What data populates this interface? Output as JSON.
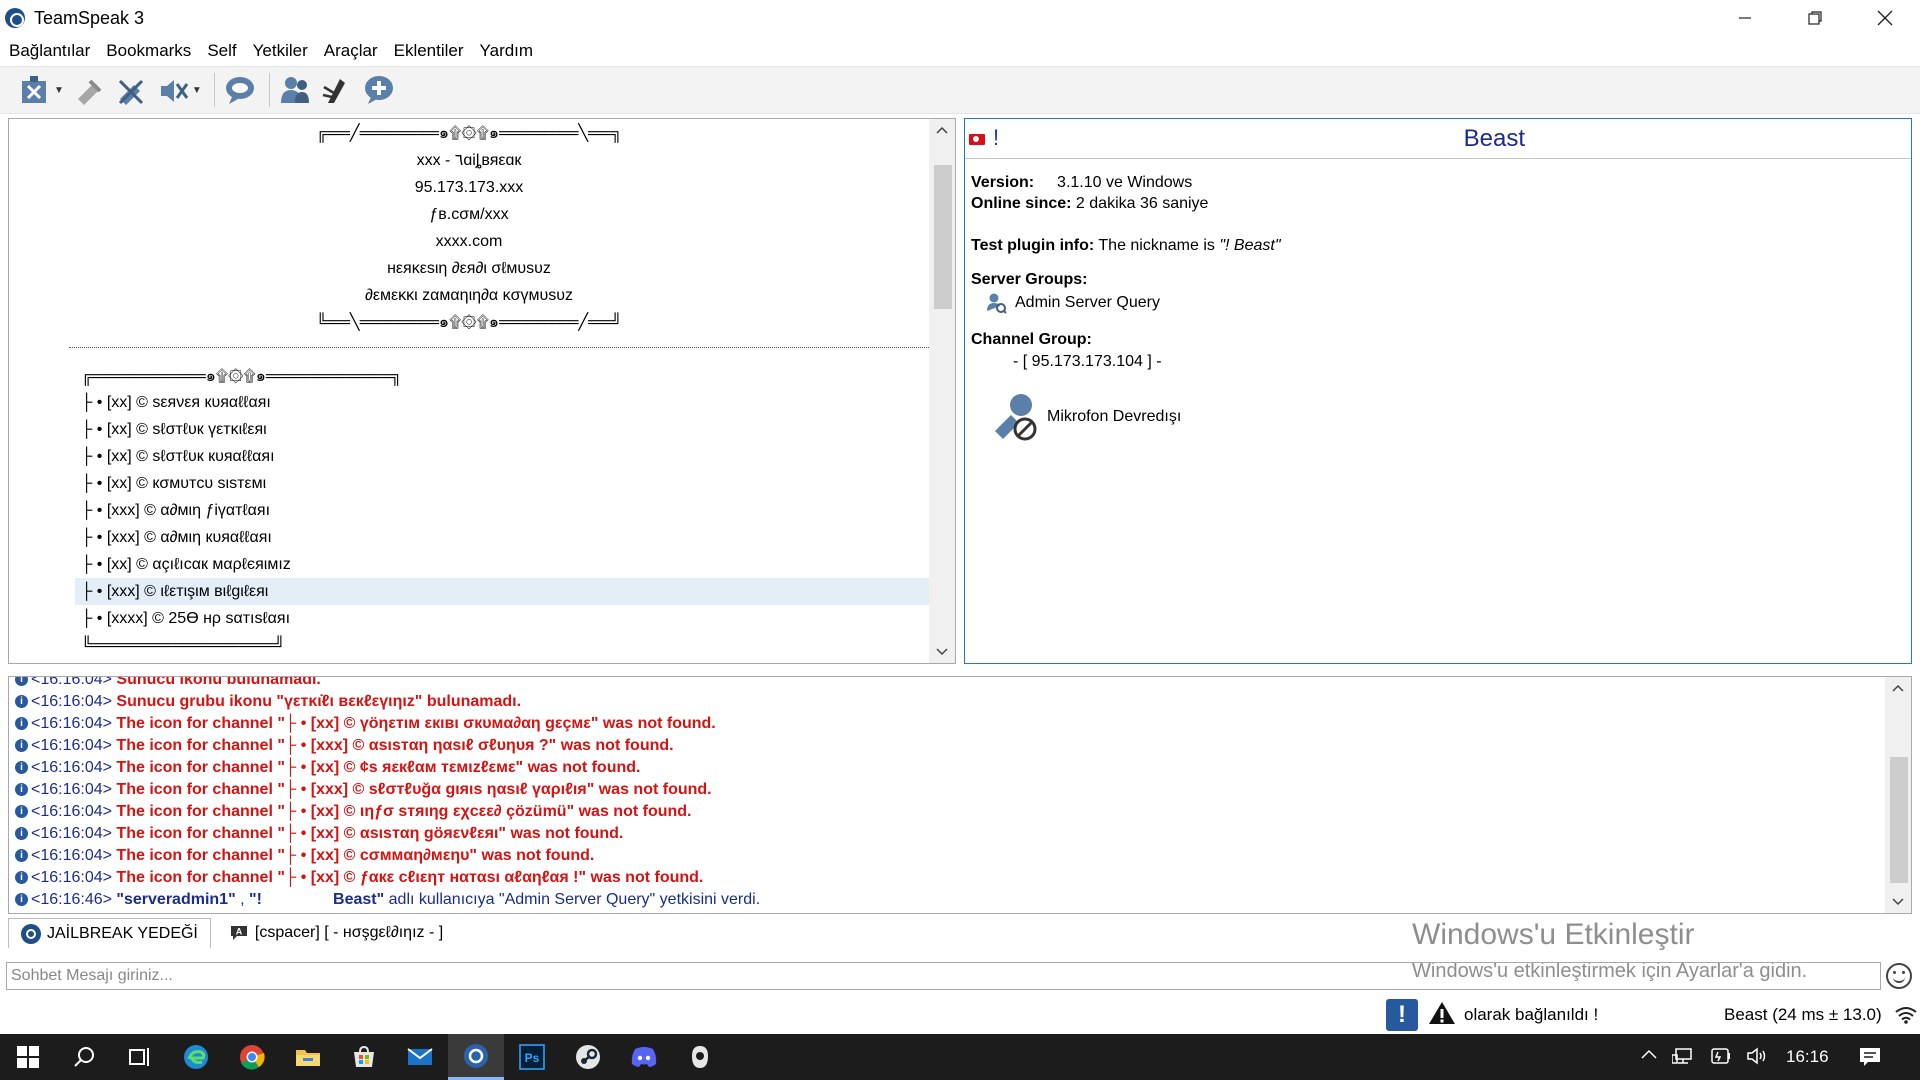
{
  "window": {
    "title": "TeamSpeak 3",
    "minimize": "—",
    "maximize": "❒",
    "close": "✕"
  },
  "menu": [
    "Bağlantılar",
    "Bookmarks",
    "Self",
    "Yetkiler",
    "Araçlar",
    "Eklentiler",
    "Yardım"
  ],
  "toolbar": {
    "buttons": [
      "disconnect-icon",
      "away-icon",
      "mute-microphone-icon",
      "mute-speakers-icon",
      "subscribe-icon",
      "contacts-icon",
      "whisper-icon",
      "add-bookmark-icon"
    ]
  },
  "channel_tree": {
    "banner": [
      "╔══╱═══════๑۩۞۩๑═══════╲══╗",
      "xxx - ٦ɑiȴвяεɑк",
      "95.173.173.xxx",
      "ƒв.cσм/xxx",
      "xxxx.com",
      "нεяĸεѕιη ∂εя∂ι σℓмυѕυz",
      "∂εмεĸĸι zαмαηιη∂α ĸσүмυѕυz",
      "╚══╲═══════๑۩۞۩๑═══════╱══╝"
    ],
    "subheader": "╔══════════๑۩۞۩๑═══════════╗",
    "channels": [
      "├ • [xx] © ѕεяνεя кυяαℓℓαяı",
      "├ • [xx] © ѕℓσтℓυк үεтĸιℓεяι",
      "├ • [xx] © ѕℓσтℓυк кυяαℓℓαяı",
      "├ • [xx] © кσмυтcυ ѕιѕтεмι",
      "├ • [xxx] © α∂мιη ƒiүαтℓαяı",
      "├ • [xxx] © α∂мιη кυяαℓℓαяı",
      "├ • [xx] © αçıℓıcαк мαρℓєяιмız",
      "├ • [xxx]  © ιℓεтιşιм вιℓgιℓεяι",
      "├ • [xxxx] © 25ϴ нρ ѕαтıѕℓαяı"
    ],
    "selected_index": 7,
    "footer": "╚════════════════╝"
  },
  "client_info": {
    "flag": "turkey-flag-icon",
    "prefix": "!",
    "nickname": "Beast",
    "version_label": "Version:",
    "version_value": "3.1.10 ve Windows",
    "online_label": "Online since:",
    "online_value": "2 dakika 36 saniye",
    "plugin_label": "Test plugin info:",
    "plugin_text": "The nickname is",
    "plugin_value": "\"! Beast\"",
    "server_groups_label": "Server Groups:",
    "server_group": "Admin Server Query",
    "channel_group_label": "Channel Group:",
    "channel_group": "- [ 95.173.173.104 ] -",
    "mic_status": "Mikrofon Devredışı"
  },
  "log": [
    {
      "time": "<16:16:04>",
      "parts": [
        {
          "t": "Sunucu ikonu bulunamadı.",
          "c": "red"
        }
      ]
    },
    {
      "time": "<16:16:04>",
      "parts": [
        {
          "t": "Sunucu grubu ikonu \"үεтĸι̇ℓι вεкℓεүιηιz\" bulunamadı.",
          "c": "red"
        }
      ]
    },
    {
      "time": "<16:16:04>",
      "parts": [
        {
          "t": "The icon for channel \"├ • [xx] © үöηεтιм εкιвι σкυмα∂αη gεçмε\" was not found.",
          "c": "red"
        }
      ]
    },
    {
      "time": "<16:16:04>",
      "parts": [
        {
          "t": "The icon for channel \"├ • [xxx] © αѕιѕтαη ηαѕıℓ σℓυηυя ?\" was not found.",
          "c": "red"
        }
      ]
    },
    {
      "time": "<16:16:04>",
      "parts": [
        {
          "t": "The icon for channel \"├ • [xx] © ¢ѕ яεкℓαм тεмιzℓεмε\" was not found.",
          "c": "red"
        }
      ]
    },
    {
      "time": "<16:16:04>",
      "parts": [
        {
          "t": "The icon for channel \"├ • [xxx] © ѕℓσтℓυğα gιяιѕ ηαѕιℓ үαρıℓıя\" was not found.",
          "c": "red"
        }
      ]
    },
    {
      "time": "<16:16:04>",
      "parts": [
        {
          "t": "The icon for channel \"├ • [xx] © ιηƒσ ѕтяιηg εχcεε∂ çözümü\" was not found.",
          "c": "red"
        }
      ]
    },
    {
      "time": "<16:16:04>",
      "parts": [
        {
          "t": "The icon for channel \"├ • [xx] © αѕιѕтαη göяενℓεяι\" was not found.",
          "c": "red"
        }
      ]
    },
    {
      "time": "<16:16:04>",
      "parts": [
        {
          "t": "The icon for channel \"├ • [xx] © cσммαη∂мεηυ\" was not found.",
          "c": "red"
        }
      ]
    },
    {
      "time": "<16:16:04>",
      "parts": [
        {
          "t": "The icon for channel \"├ • [xx] © ƒαкε cℓιεηт нαтαѕı αℓαηℓαя !\" was not found.",
          "c": "red"
        }
      ]
    },
    {
      "time": "<16:16:46>",
      "parts": [
        {
          "t": "\"serveradmin1\"",
          "c": "blueb"
        },
        {
          "t": " , ",
          "c": "blue"
        },
        {
          "t": "\"!                Beast\"",
          "c": "blueb"
        },
        {
          "t": " adlı kullanıcıya \"Admin Server Query\" yetkisini verdi.",
          "c": "blue"
        }
      ]
    }
  ],
  "tabs": [
    {
      "label": "JAİLBREAK YEDEĞİ",
      "icon": "teamspeak-server-icon"
    },
    {
      "label": "[cspacer] [ - нσşgεℓ∂ıηız - ]",
      "icon": "channel-chat-icon"
    }
  ],
  "watermark": {
    "title": "Windows'u Etkinleştir",
    "subtitle": "Windows'u etkinleştirmek için Ayarlar'a gidin."
  },
  "chat": {
    "placeholder": "Sohbet Mesajı giriniz..."
  },
  "status": {
    "connected_text": "olarak bağlanıldı !",
    "ping_text": "Beast (24 ms ± 13.0)"
  },
  "taskbar": {
    "time": "16:16",
    "apps": [
      "start-icon",
      "search-icon",
      "task-view-icon",
      "edge-icon",
      "chrome-icon",
      "file-explorer-icon",
      "store-icon",
      "mail-icon",
      "teamspeak-icon",
      "photoshop-icon",
      "steam-icon",
      "discord-icon",
      "app-icon"
    ],
    "photoshop_label": "Ps"
  }
}
